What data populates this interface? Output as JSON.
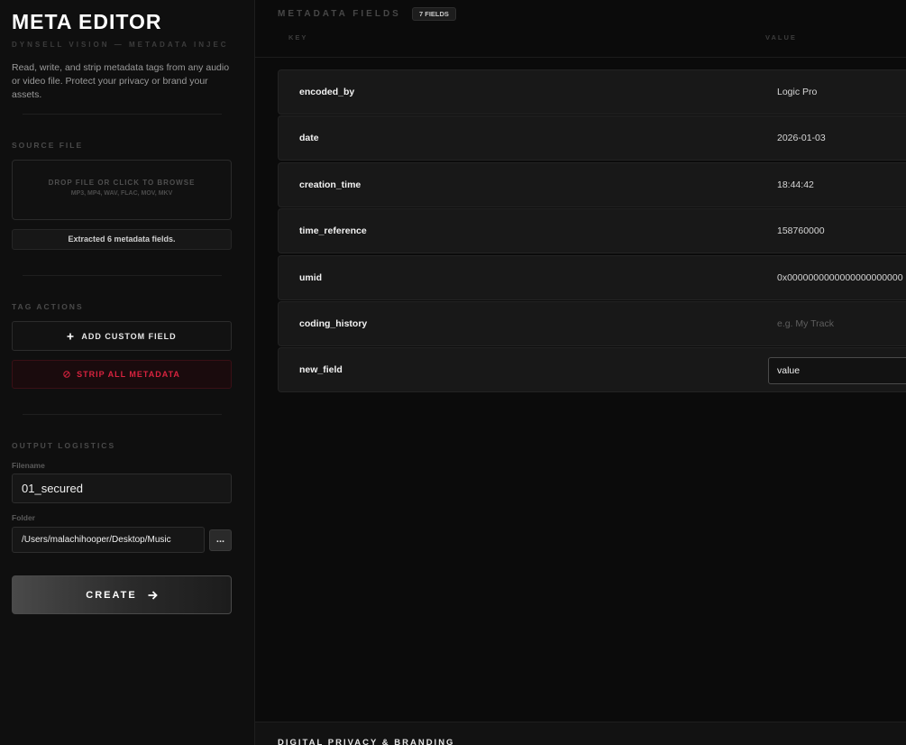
{
  "sidebar": {
    "title": "META EDITOR",
    "subtitle": "DYNSELL VISION — METADATA INJEC",
    "description": "Read, write, and strip metadata tags from any audio or video file. Protect your privacy or brand your assets.",
    "source": {
      "label": "SOURCE FILE",
      "drop_text": "DROP FILE OR CLICK TO BROWSE",
      "formats": "MP3, MP4, WAV, FLAC, MOV, MKV",
      "status": "Extracted 6 metadata fields."
    },
    "actions": {
      "label": "TAG ACTIONS",
      "add_label": "ADD CUSTOM FIELD",
      "add_icon_glyph": "+",
      "strip_label": "STRIP ALL METADATA",
      "strip_icon_glyph": "⊘"
    },
    "output": {
      "label": "OUTPUT LOGISTICS",
      "filename_label": "Filename",
      "filename_value": "01_secured",
      "folder_label": "Folder",
      "folder_value": "/Users/malachihooper/Desktop/Music",
      "browse_label": "...",
      "create_label": "CREATE",
      "create_icon_glyph": "→"
    }
  },
  "main": {
    "title": "METADATA FIELDS",
    "count_badge": "7 FIELDS",
    "columns": {
      "key": "KEY",
      "value": "VALUE"
    },
    "rows": [
      {
        "key": "encoded_by",
        "value": "Logic Pro"
      },
      {
        "key": "date",
        "value": "2026-01-03"
      },
      {
        "key": "creation_time",
        "value": "18:44:42"
      },
      {
        "key": "time_reference",
        "value": "158760000"
      },
      {
        "key": "umid",
        "value": "0x0000000000000000000000"
      },
      {
        "key": "coding_history",
        "value": "",
        "placeholder": "e.g. My Track"
      },
      {
        "key": "new_field",
        "value": "value"
      }
    ],
    "footer_title": "DIGITAL PRIVACY & BRANDING"
  },
  "colors": {
    "background": "#0b0b0b",
    "sidebar": "#0f0f0f",
    "row": "#181818",
    "danger": "#d8233f",
    "text": "#f2f2f2"
  },
  "icons": {
    "add": "plus-icon",
    "strip": "block-icon",
    "create": "arrow-right-icon"
  }
}
